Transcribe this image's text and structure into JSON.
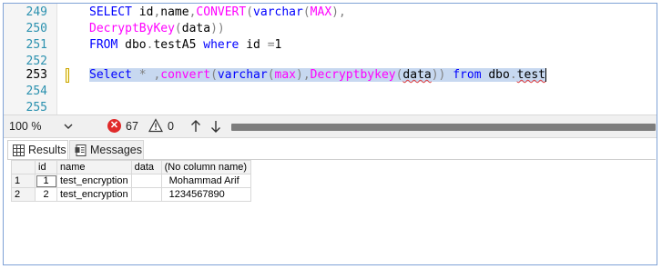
{
  "editor": {
    "lines": [
      {
        "number": "249",
        "code": "SELECT id,name,CONVERT(varchar(MAX),"
      },
      {
        "number": "250",
        "code": "DecryptByKey(data))"
      },
      {
        "number": "251",
        "code": "FROM dbo.testA5 where id =1"
      },
      {
        "number": "252",
        "code": ""
      },
      {
        "number": "253",
        "code": "Select * ,convert(varchar(max),Decryptbykey(data)) from dbo.test"
      },
      {
        "number": "254",
        "code": ""
      },
      {
        "number": "255",
        "code": ""
      }
    ],
    "current_line": "253"
  },
  "status": {
    "zoom": "100 %",
    "error_count": "67",
    "warning_count": "0"
  },
  "results": {
    "tabs": [
      {
        "label": "Results",
        "active": true
      },
      {
        "label": "Messages",
        "active": false
      }
    ],
    "columns": [
      "",
      "id",
      "name",
      "data",
      "(No column name)"
    ],
    "rows": [
      {
        "row_number": "1",
        "id": "1",
        "name": "test_encryption",
        "data": "",
        "decrypted": "Mohammad Arif"
      },
      {
        "row_number": "2",
        "id": "2",
        "name": "test_encryption",
        "data": "",
        "decrypted": "1234567890"
      }
    ]
  },
  "colors": {
    "keyword": "#0000ff",
    "function": "#ff00ff",
    "selection": "#c7d8f0",
    "error": "#e02a2a"
  }
}
